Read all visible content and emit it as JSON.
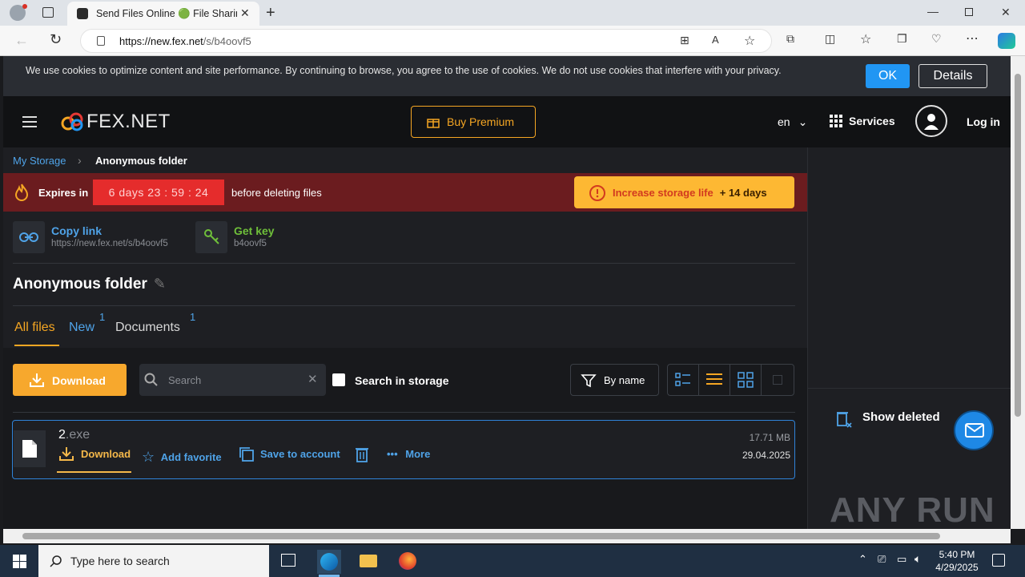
{
  "browser": {
    "tab_title": "Send Files Online 🟢 File Sharing",
    "url_host": "https://new.fex.net",
    "url_path": "/s/b4oovf5"
  },
  "cookie": {
    "text": "We use cookies to optimize content and site performance. By continuing to browse, you agree to the use of cookies. We do not use cookies that interfere with your privacy.",
    "ok_label": "OK",
    "details_label": "Details"
  },
  "header": {
    "logo": "FEX.NET",
    "buy_premium": "Buy Premium",
    "lang": "en",
    "services": "Services",
    "login": "Log in"
  },
  "breadcrumb": {
    "root": "My Storage",
    "current": "Anonymous folder"
  },
  "expire": {
    "label": "Expires in",
    "timer": "6 days  23 : 59 : 24",
    "after": "before deleting files",
    "increase_label": "Increase storage life",
    "increase_days": "+ 14 days"
  },
  "links": {
    "copy_title": "Copy link",
    "copy_url": "https://new.fex.net/s/b4oovf5",
    "key_title": "Get key",
    "key_value": "b4oovf5"
  },
  "folder": {
    "title": "Anonymous folder"
  },
  "tabs": {
    "all": "All files",
    "new": "New",
    "new_count": "1",
    "docs": "Documents",
    "docs_count": "1"
  },
  "toolbar": {
    "download": "Download",
    "search_placeholder": "Search",
    "search_in_storage": "Search in storage",
    "sort": "By name"
  },
  "file": {
    "name": "2",
    "ext": ".exe",
    "size": "17.71 MB",
    "date": "29.04.2025",
    "action_download": "Download",
    "action_favorite": "Add favorite",
    "action_save": "Save to account",
    "action_more": "More"
  },
  "side": {
    "show_deleted": "Show deleted",
    "watermark": "ANY RUN"
  },
  "taskbar": {
    "search": "Type here to search",
    "time": "5:40 PM",
    "date": "4/29/2025"
  }
}
